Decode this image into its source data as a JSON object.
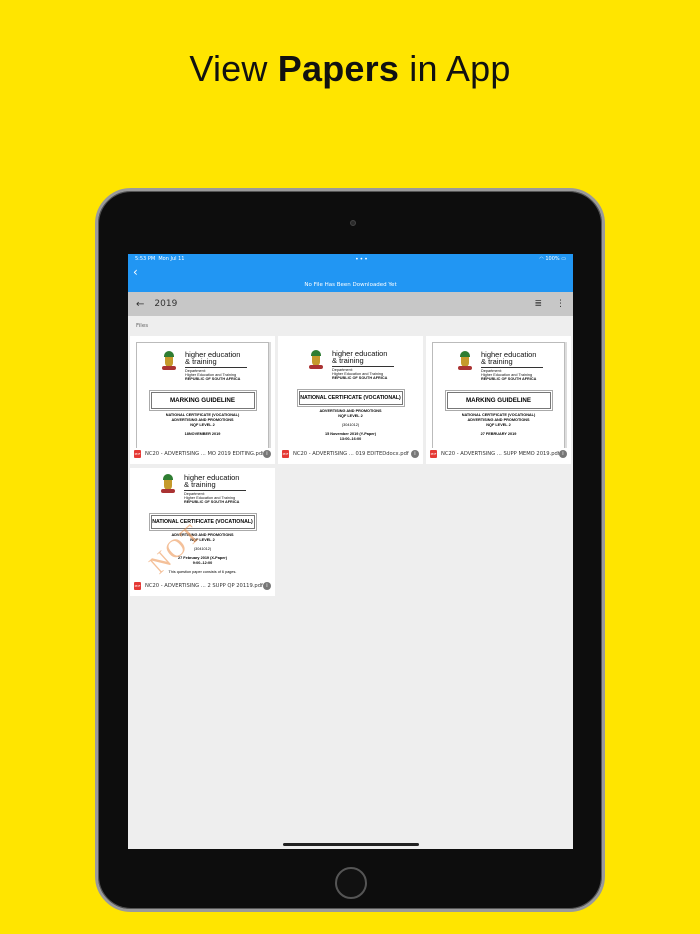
{
  "headline": {
    "pre": "View ",
    "bold": "Papers",
    "post": " in App"
  },
  "status": {
    "time": "5:53 PM",
    "date": "Mon Jul 11",
    "dots": "•••",
    "battery": "100%"
  },
  "topbar": {
    "back_icon": "chevron-left-icon",
    "banner": "No File Has Been Downloaded Yet"
  },
  "navbar": {
    "title": "2019",
    "list_icon": "≣",
    "more_icon": "⋮"
  },
  "section_label": "Files",
  "org": {
    "name_line1": "higher education",
    "name_line2": "& training",
    "dept_line1": "Department:",
    "dept_line2": "Higher Education and Training",
    "dept_line3": "REPUBLIC OF SOUTH AFRICA"
  },
  "files": [
    {
      "name": "NC20 - ADVERTISING ... MO 2019 EDITING.pdf",
      "box": "MARKING GUIDELINE",
      "l1": "NATIONAL CERTIFICATE (VOCATIONAL)",
      "l2": "ADVERTISING AND PROMOTIONS",
      "l3": "NQF LEVEL 2",
      "l4": "18NOVEMBER 2019"
    },
    {
      "name": "NC20 - ADVERTISING ... 019  EDITEDdocx.pdf",
      "box": "NATIONAL CERTIFICATE (VOCATIONAL)",
      "l1": "ADVERTISING AND PROMOTIONS",
      "l2": "NQF LEVEL 2",
      "l3": "(3041012)",
      "l4": "15 November 2019 (Y-Paper)",
      "l5": "13:00–16:00"
    },
    {
      "name": "NC20 - ADVERTISING ... SUPP MEMO 2019.pdf",
      "box": "MARKING GUIDELINE",
      "l1": "NATIONAL CERTIFICATE (VOCATIONAL)",
      "l2": "ADVERTISING AND PROMOTIONS",
      "l3": "NQF LEVEL 2",
      "l4": "27 FEBRUARY 2019"
    },
    {
      "name": "NC20 - ADVERTISING ... 2 SUPP QP 20119.pdf",
      "box": "NATIONAL CERTIFICATE (VOCATIONAL)",
      "l1": "ADVERTISING AND PROMOTIONS",
      "l2": "NQF LEVEL 2",
      "l3": "(3041012)",
      "l4": "27 February 2019 (X-Paper)",
      "l5": "9:00–12:00",
      "l6": "This question paper consists of 6 pages.",
      "watermark": "NOT"
    }
  ],
  "pdf_badge": "PDF",
  "info_icon": "i",
  "colors": {
    "background": "#FFE500",
    "topbar": "#2196F3",
    "navbar": "#C7C7C7"
  }
}
